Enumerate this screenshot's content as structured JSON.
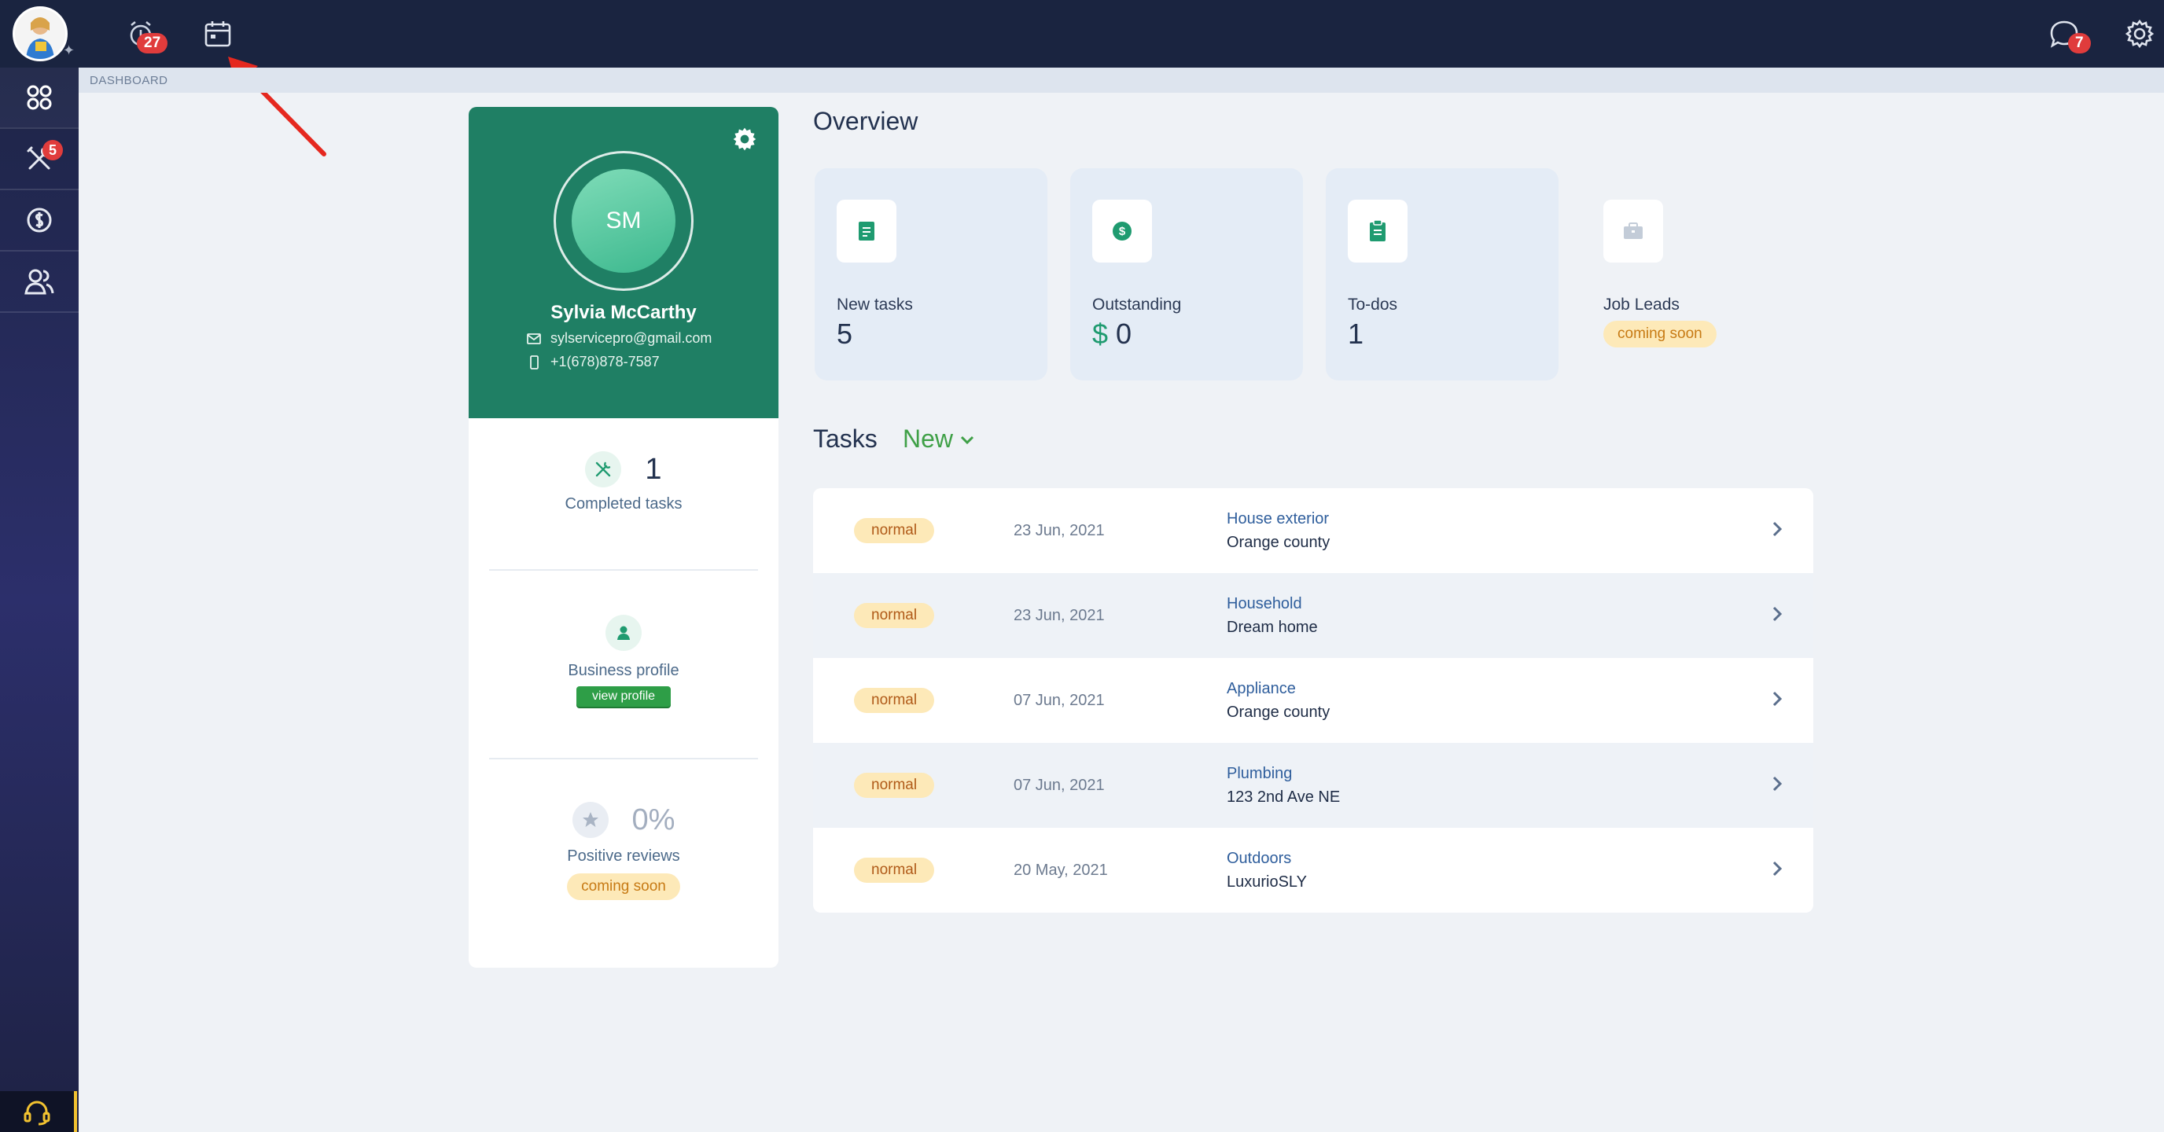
{
  "topbar": {
    "alarm_badge": "27",
    "messages_badge": "7"
  },
  "sidebar": {
    "tools_badge": "5"
  },
  "breadcrumb": "DASHBOARD",
  "profile": {
    "initials": "SM",
    "name": "Sylvia McCarthy",
    "email": "sylservicepro@gmail.com",
    "phone": "+1(678)878-7587",
    "completed_count": "1",
    "completed_label": "Completed tasks",
    "business_label": "Business profile",
    "view_profile": "view profile",
    "reviews_percent": "0%",
    "reviews_label": "Positive reviews",
    "reviews_soon": "coming soon"
  },
  "overview": {
    "title": "Overview",
    "cards": [
      {
        "label": "New tasks",
        "value": "5",
        "icon": "document-icon"
      },
      {
        "label": "Outstanding",
        "currency": "$",
        "value": "0",
        "icon": "dollar-icon"
      },
      {
        "label": "To-dos",
        "value": "1",
        "icon": "clipboard-icon"
      },
      {
        "label": "Job Leads",
        "badge": "coming soon",
        "icon": "briefcase-icon"
      }
    ]
  },
  "tasks": {
    "title": "Tasks",
    "filter": "New",
    "rows": [
      {
        "priority": "normal",
        "date": "23 Jun, 2021",
        "category": "House exterior",
        "location": "Orange county"
      },
      {
        "priority": "normal",
        "date": "23 Jun, 2021",
        "category": "Household",
        "location": "Dream home"
      },
      {
        "priority": "normal",
        "date": "07 Jun, 2021",
        "category": "Appliance",
        "location": "Orange county"
      },
      {
        "priority": "normal",
        "date": "07 Jun, 2021",
        "category": "Plumbing",
        "location": "123 2nd Ave NE"
      },
      {
        "priority": "normal",
        "date": "20 May, 2021",
        "category": "Outdoors",
        "location": "LuxurioSLY"
      }
    ]
  },
  "colors": {
    "topbar": "#1a2440",
    "accent_green": "#1f7f64",
    "badge_red": "#e03c3c",
    "priority_bg": "#fde9b8"
  }
}
